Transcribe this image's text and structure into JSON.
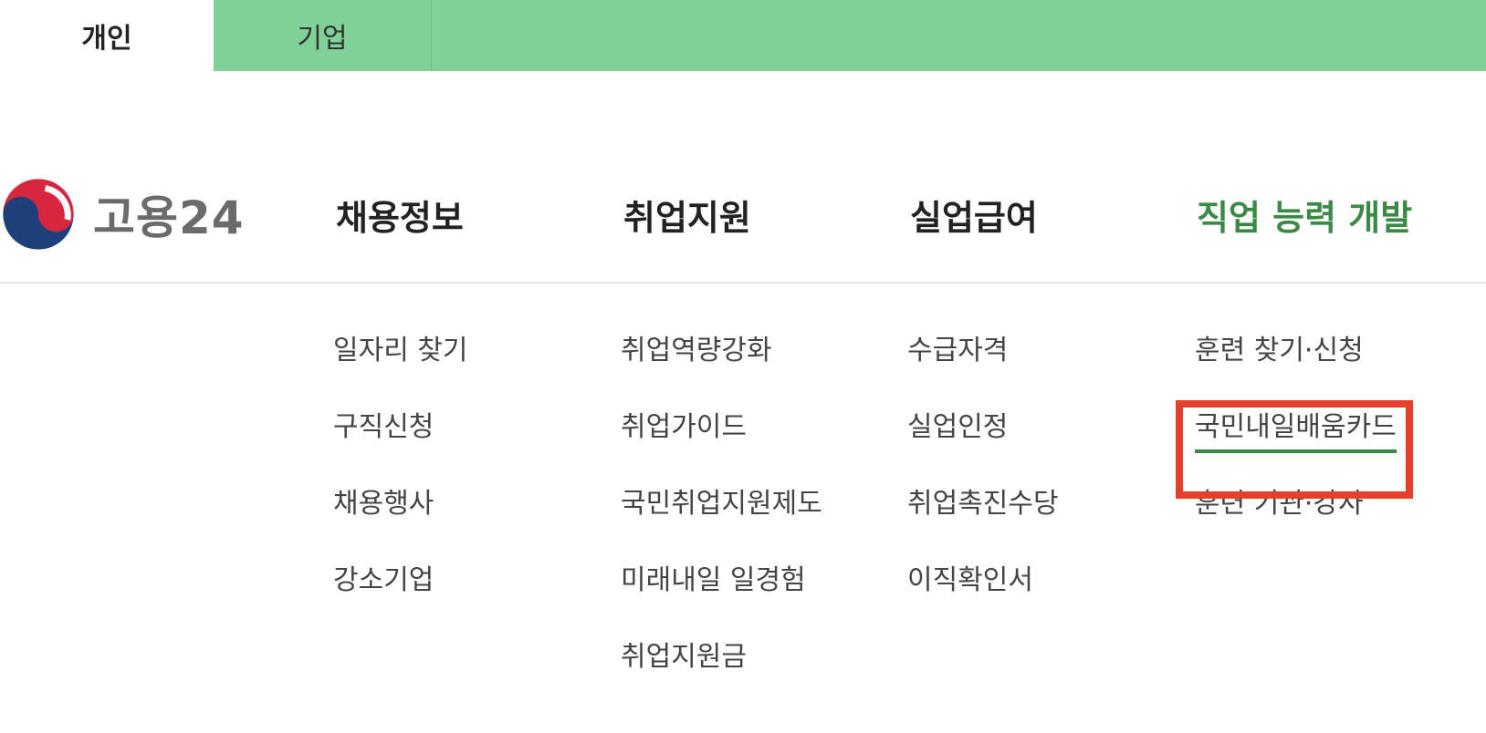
{
  "top_tabs": [
    {
      "label": "개인",
      "selected": true
    },
    {
      "label": "기업",
      "selected": false
    }
  ],
  "colors": {
    "topbar_bg": "#80d197",
    "accent_green": "#3a8a45",
    "highlight_red": "#e4402b"
  },
  "logo": {
    "text": "고용24",
    "icon": "taegeuk-logo-icon"
  },
  "main_nav": [
    {
      "label": "채용정보",
      "active": false
    },
    {
      "label": "취업지원",
      "active": false
    },
    {
      "label": "실업급여",
      "active": false
    },
    {
      "label": "직업 능력 개발",
      "active": true
    }
  ],
  "submenus": [
    {
      "items": [
        "일자리 찾기",
        "구직신청",
        "채용행사",
        "강소기업"
      ]
    },
    {
      "items": [
        "취업역량강화",
        "취업가이드",
        "국민취업지원제도",
        "미래내일 일경험",
        "취업지원금"
      ]
    },
    {
      "items": [
        "수급자격",
        "실업인정",
        "취업촉진수당",
        "이직확인서"
      ]
    },
    {
      "items": [
        "훈련 찾기·신청",
        "국민내일배움카드",
        "훈련 기관·강사"
      ],
      "highlighted_index": 1
    }
  ]
}
